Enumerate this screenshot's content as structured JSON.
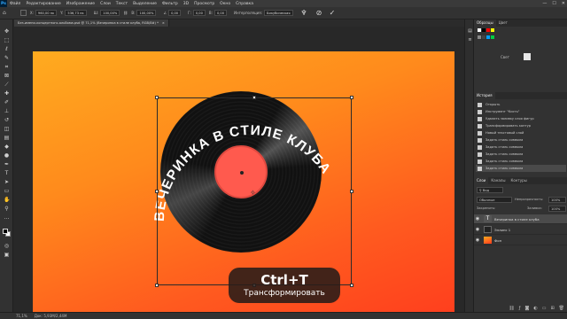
{
  "menubar": {
    "app_logo": "Ps",
    "items": [
      "Файл",
      "Редактирование",
      "Изображение",
      "Слои",
      "Текст",
      "Выделение",
      "Фильтр",
      "3D",
      "Просмотр",
      "Окно",
      "Справка"
    ],
    "window_controls": [
      "—",
      "☐",
      "✕"
    ]
  },
  "options": {
    "x_label": "X:",
    "x_value": "960,00 пк",
    "y_label": "Y:",
    "y_value": "536,73 пк",
    "w_label": "Ш:",
    "w_value": "100,00%",
    "h_label": "В:",
    "h_value": "100,00%",
    "angle_label": "∠",
    "angle_value": "0,00",
    "skew_h_label": "Г:",
    "skew_h_value": "0,00",
    "skew_v_label": "В:",
    "skew_v_value": "0,00",
    "interp_label": "Интерполяция:",
    "interp_value": "Бикубическая"
  },
  "document_tab": {
    "title": "Без-имени-концертного-альбома.psd @ 71,1% (Вечеринка в стиле клуба, RGB/8#) *",
    "close_icon": "×"
  },
  "canvas": {
    "arc_text": "ВЕЧЕРИНКА В СТИЛЕ КЛУБА",
    "colors": {
      "gradient_top": "#ffab1f",
      "gradient_bottom": "#ff3a1d",
      "record_label": "#ff5a4e"
    }
  },
  "tooltip": {
    "shortcut": "Ctrl+T",
    "description": "Трансформировать"
  },
  "statusbar": {
    "zoom": "71,1%",
    "doc_info": "Док: 5,93М/2,44М"
  },
  "panels": {
    "swatches_tabs": [
      "Образцы",
      "Цвет"
    ],
    "swatches_label": "Свет",
    "history_tabs": [
      "История"
    ],
    "history_items": [
      "Открыть",
      "Инструмент \"Кисть\"",
      "Удалить заливку слоя фигур",
      "Трансформировать контур",
      "Новый текстовый слой",
      "Задать стиль символа",
      "Задать стиль символа",
      "Задать стиль символа",
      "Задать стиль символа",
      "Задать стиль символа"
    ],
    "layers_tabs": [
      "Слои",
      "Каналы",
      "Контуры"
    ],
    "layers_filter": "Вид",
    "blend_mode": "Обычные",
    "opacity_label": "Непрозрачность:",
    "opacity_value": "100%",
    "lock_label": "Закрепить:",
    "fill_label": "Заливка:",
    "fill_value": "100%",
    "layers": [
      {
        "name": "Вечеринка в стиле клуба",
        "thumb": "T"
      },
      {
        "name": "Эллипс 1",
        "thumb": ""
      },
      {
        "name": "Фон",
        "thumb": ""
      }
    ]
  }
}
